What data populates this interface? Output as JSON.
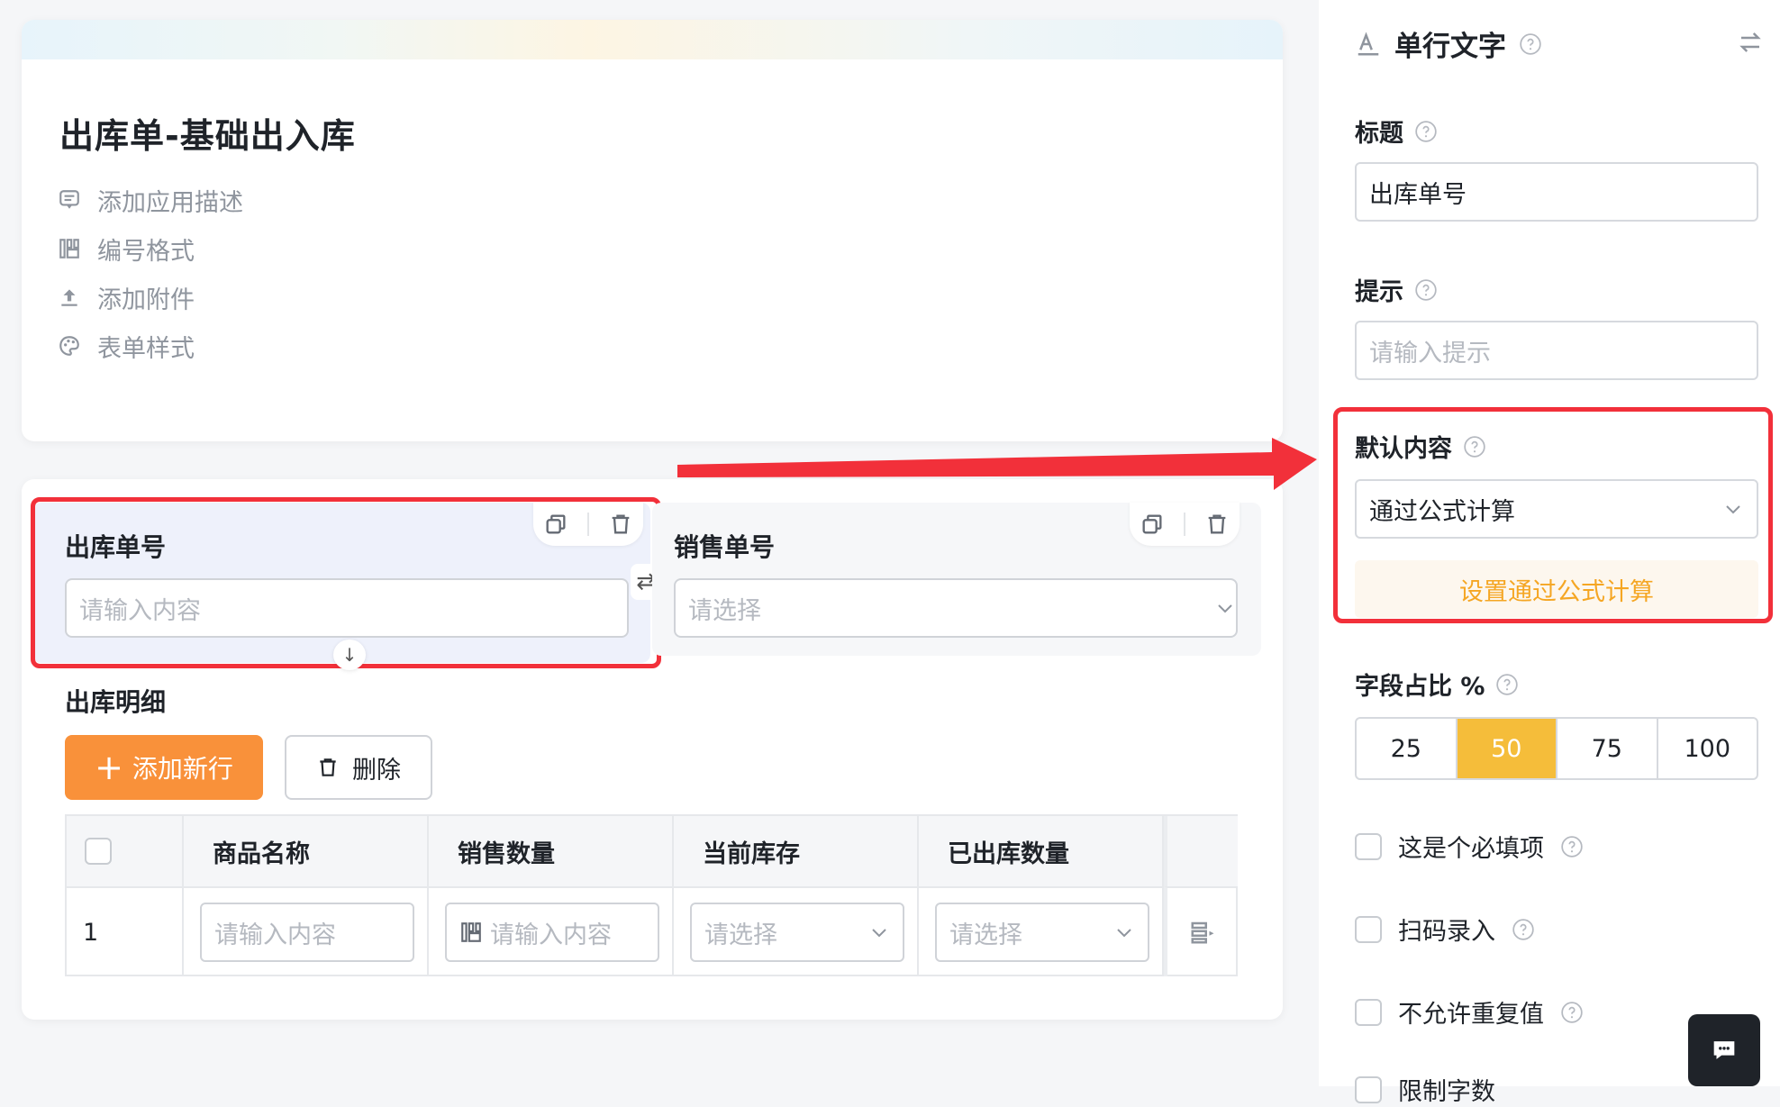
{
  "form": {
    "title": "出库单-基础出入库",
    "links": [
      "添加应用描述",
      "编号格式",
      "添加附件",
      "表单样式"
    ]
  },
  "fields": {
    "order_no": {
      "label": "出库单号",
      "placeholder": "请输入内容"
    },
    "sale_no": {
      "label": "销售单号",
      "placeholder": "请选择"
    }
  },
  "detail": {
    "label": "出库明细",
    "add_button": "添加新行",
    "delete_button": "删除",
    "columns": [
      "商品名称",
      "销售数量",
      "当前库存",
      "已出库数量"
    ],
    "row": {
      "index": "1",
      "name_placeholder": "请输入内容",
      "qty_placeholder": "请输入内容",
      "stock_placeholder": "请选择",
      "shipped_placeholder": "请选择"
    }
  },
  "panel": {
    "type_title": "单行文字",
    "title_label": "标题",
    "title_value": "出库单号",
    "hint_label": "提示",
    "hint_placeholder": "请输入提示",
    "default_label": "默认内容",
    "default_value": "通过公式计算",
    "formula_button": "设置通过公式计算",
    "ratio_label": "字段占比 %",
    "ratio_options": [
      "25",
      "50",
      "75",
      "100"
    ],
    "ratio_selected": "50",
    "checks": [
      "这是个必填项",
      "扫码录入",
      "不允许重复值",
      "限制字数"
    ]
  },
  "colors": {
    "accent_orange": "#f9913a",
    "ratio_active": "#f5bd3a",
    "annotation_red": "#f2303a",
    "formula_text": "#f5a623"
  }
}
